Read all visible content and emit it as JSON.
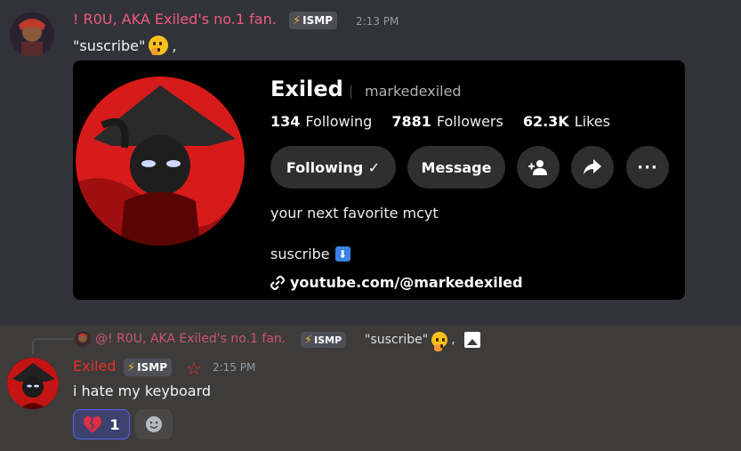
{
  "message1": {
    "username": "! R0U, AKA Exiled's no.1 fan.",
    "badge": "ISMP",
    "time": "2:13 PM",
    "text": "\"suscribe\"",
    "text_suffix": ",",
    "emoji": "thinking-face"
  },
  "embed": {
    "name": "Exiled",
    "handle": "markedexiled",
    "stats": [
      {
        "value": "134",
        "label": "Following"
      },
      {
        "value": "7881",
        "label": "Followers"
      },
      {
        "value": "62.3K",
        "label": "Likes"
      }
    ],
    "following_label": "Following ✓",
    "message_label": "Message",
    "bio": "your next favorite mcyt",
    "subscribe_text": "suscribe",
    "link": "youtube.com/@markedexiled"
  },
  "message2": {
    "reply_username": "@! R0U, AKA Exiled's no.1 fan.",
    "reply_badge": "ISMP",
    "reply_text": "\"suscribe\"",
    "reply_suffix": ",",
    "username": "Exiled",
    "badge": "ISMP",
    "time": "2:15 PM",
    "text": "i hate my keyboard",
    "reaction": {
      "emoji": "broken-heart",
      "count": "1"
    }
  },
  "colors": {
    "background": "#313338",
    "reply_background": "#3d3c3a",
    "username1": "#ee5a7f",
    "username2": "#e62e2e",
    "reaction_border": "#5865f2"
  }
}
